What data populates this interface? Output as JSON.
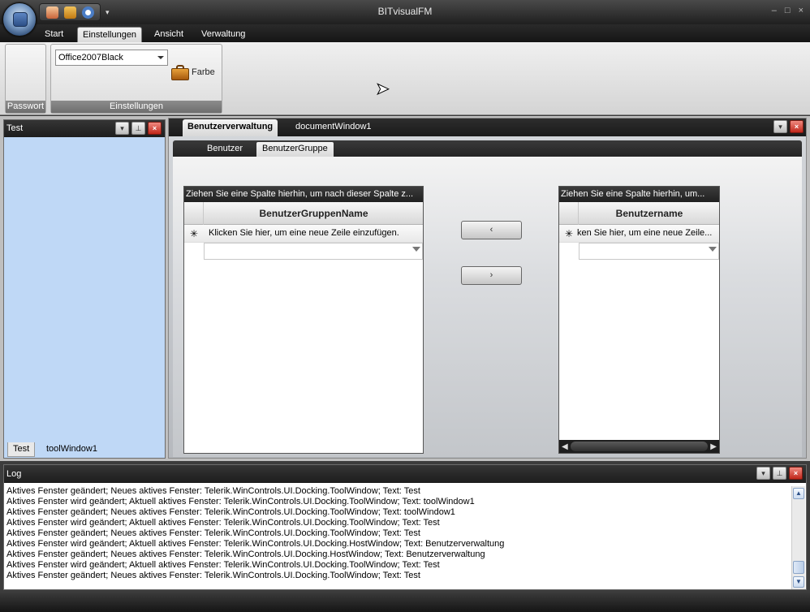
{
  "app": {
    "title": "BITvisualFM",
    "window_controls": [
      "–",
      "□",
      "×"
    ]
  },
  "quick_access": {
    "icons": [
      "user-icon",
      "folder-icon",
      "clock-icon"
    ],
    "dropdown_icon": "▾"
  },
  "ribbon": {
    "tabs": [
      "Start",
      "Einstellungen",
      "Ansicht",
      "Verwaltung"
    ],
    "active_tab": "Einstellungen",
    "groups": {
      "passwort": {
        "label": "Passwort"
      },
      "einstellungen": {
        "label": "Einstellungen",
        "theme_value": "Office2007Black",
        "farbe_label": "Farbe"
      }
    }
  },
  "toolwindow": {
    "title": "Test",
    "tabs": [
      "Test",
      "toolWindow1"
    ],
    "active_tab": "Test",
    "buttons": [
      "▾",
      "⊥",
      "×"
    ]
  },
  "document": {
    "tabs": [
      "Benutzerverwaltung",
      "documentWindow1"
    ],
    "active_tab": "Benutzerverwaltung",
    "page_tabs": [
      "Benutzer",
      "BenutzerGruppe"
    ],
    "active_page_tab": "BenutzerGruppe",
    "left_grid": {
      "group_panel": "Ziehen Sie eine Spalte hierhin, um nach dieser Spalte z...",
      "column": "BenutzerGruppenName",
      "new_row": "Klicken Sie hier, um eine neue Zeile einzufügen."
    },
    "right_grid": {
      "group_panel": "Ziehen Sie eine Spalte hierhin, um...",
      "column": "Benutzername",
      "new_row": "ken Sie hier, um eine neue Zeile..."
    },
    "move_left_label": "‹",
    "move_right_label": "›"
  },
  "log": {
    "title": "Log",
    "lines": [
      "Aktives Fenster geändert; Neues aktives Fenster: Telerik.WinControls.UI.Docking.ToolWindow; Text: Test",
      "Aktives Fenster wird geändert; Aktuell aktives Fenster: Telerik.WinControls.UI.Docking.ToolWindow; Text: toolWindow1",
      "Aktives Fenster geändert; Neues aktives Fenster: Telerik.WinControls.UI.Docking.ToolWindow; Text: toolWindow1",
      "Aktives Fenster wird geändert; Aktuell aktives Fenster: Telerik.WinControls.UI.Docking.ToolWindow; Text: Test",
      "Aktives Fenster geändert; Neues aktives Fenster: Telerik.WinControls.UI.Docking.ToolWindow; Text: Test",
      "Aktives Fenster wird geändert; Aktuell aktives Fenster: Telerik.WinControls.UI.Docking.HostWindow; Text: Benutzerverwaltung",
      "Aktives Fenster geändert; Neues aktives Fenster: Telerik.WinControls.UI.Docking.HostWindow; Text: Benutzerverwaltung",
      "Aktives Fenster wird geändert; Aktuell aktives Fenster: Telerik.WinControls.UI.Docking.ToolWindow; Text: Test",
      "Aktives Fenster geändert; Neues aktives Fenster: Telerik.WinControls.UI.Docking.ToolWindow; Text: Test"
    ]
  },
  "colors": {
    "dark_chrome": "#1f1f1f",
    "toolwindow_bg": "#bfd8f6",
    "close_red": "#c0261a"
  }
}
